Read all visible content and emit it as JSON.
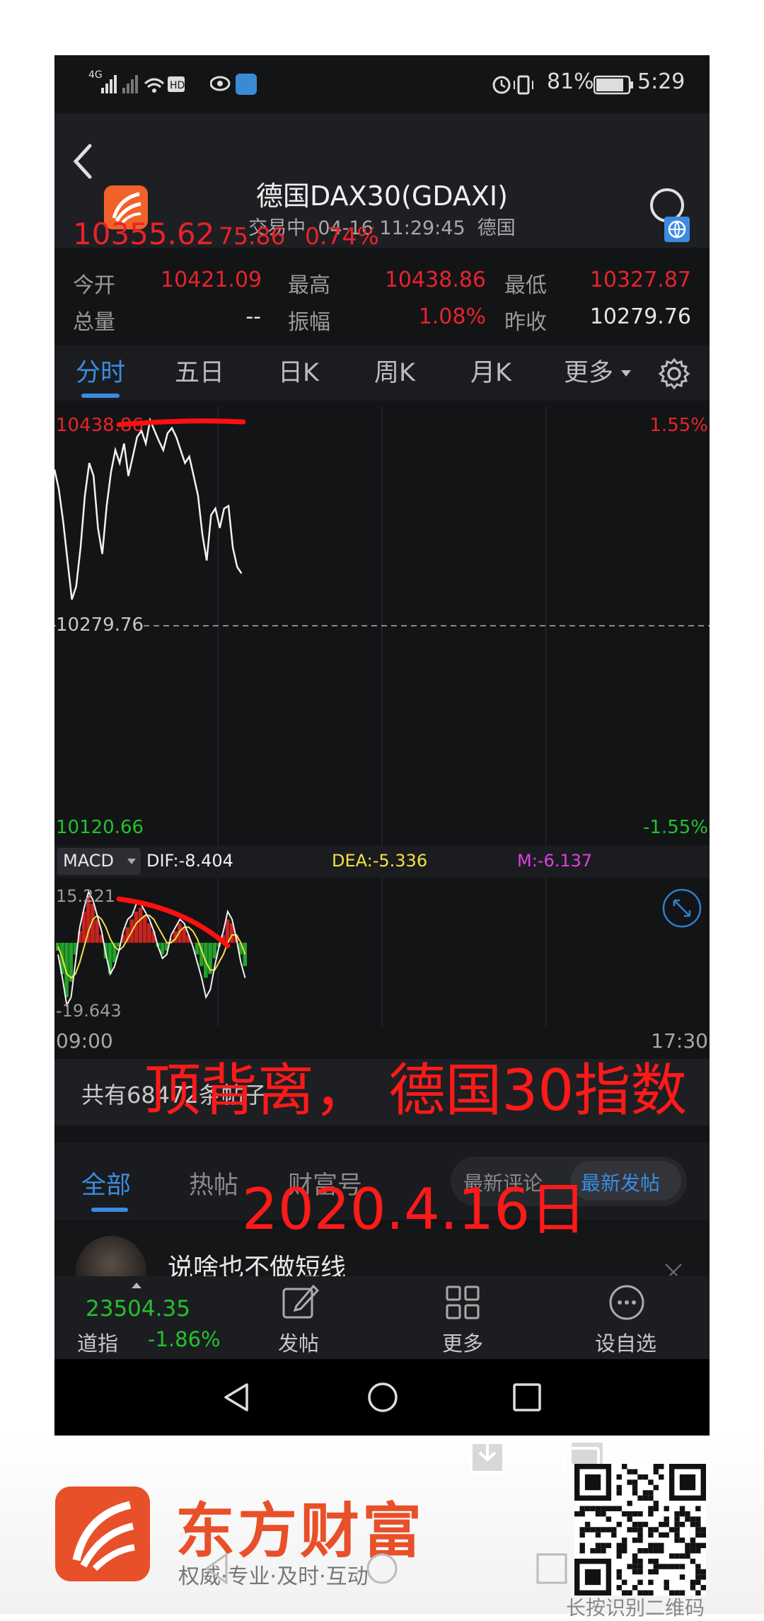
{
  "status": {
    "signal": "4G",
    "battery": "81%",
    "time": "5:29"
  },
  "header": {
    "title": "德国DAX30(GDAXI)",
    "subtitle": "交易中  04-16 11:29:45  德国"
  },
  "quote": {
    "price": "10355.62",
    "change": "75.86",
    "change_pct": "0.74%",
    "open_label": "今开",
    "open": "10421.09",
    "high_label": "最高",
    "high": "10438.86",
    "low_label": "最低",
    "low": "10327.87",
    "volume_label": "总量",
    "volume": "--",
    "amplitude_label": "振幅",
    "amplitude": "1.08%",
    "prev_close_label": "昨收",
    "prev_close": "10279.76"
  },
  "tabs": [
    "分时",
    "五日",
    "日K",
    "周K",
    "月K",
    "更多"
  ],
  "chart_data": {
    "type": "line",
    "title": "",
    "price_top_label": "10438.86",
    "price_mid_label": "10279.76",
    "price_bottom_label": "10120.66",
    "pct_top_label": "1.55%",
    "pct_bottom_label": "-1.55%",
    "ylim": [
      10120.66,
      10438.86
    ],
    "x_start": "09:00",
    "x_end": "17:30",
    "series": [
      {
        "values": [
          10400,
          10385,
          10360,
          10330,
          10300,
          10310,
          10340,
          10380,
          10405,
          10395,
          10355,
          10335,
          10372,
          10398,
          10415,
          10405,
          10420,
          10395,
          10410,
          10425,
          10430,
          10420,
          10438,
          10430,
          10422,
          10415,
          10428,
          10432,
          10425,
          10415,
          10405,
          10410,
          10395,
          10380,
          10350,
          10330,
          10365,
          10370,
          10355,
          10370,
          10372,
          10340,
          10325,
          10320
        ]
      }
    ],
    "macd": {
      "label": "MACD",
      "dif": "DIF:-8.404",
      "dea": "DEA:-5.336",
      "m": "M:-6.137",
      "top_label": "15.221",
      "bottom_label": "-19.643",
      "ylim": [
        -19.643,
        15.221
      ],
      "hist": [
        -2,
        -8,
        -14,
        -10,
        -3,
        3,
        8,
        12,
        10,
        6,
        2,
        -4,
        -8,
        -5,
        -1,
        2,
        4,
        6,
        8,
        9,
        7,
        5,
        3,
        -1,
        -3,
        -2,
        1,
        3,
        5,
        4,
        2,
        0,
        -3,
        -6,
        -9,
        -8,
        -4,
        -1,
        2,
        6,
        5,
        2,
        -3,
        -6
      ],
      "dif_series": [
        -3,
        -9,
        -16,
        -14,
        -5,
        4,
        9,
        13,
        11,
        7,
        3,
        -3,
        -8,
        -6,
        -2,
        3,
        6,
        7,
        10,
        10,
        8,
        6,
        3,
        -1,
        -4,
        -3,
        2,
        4,
        6,
        5,
        2,
        -1,
        -5,
        -9,
        -14,
        -12,
        -6,
        -1,
        3,
        8,
        6,
        1,
        -5,
        -9
      ],
      "dea_series": [
        -1,
        -4,
        -8,
        -9,
        -8,
        -5,
        -1,
        3,
        6,
        7,
        6,
        4,
        1,
        -1,
        -2,
        -1,
        1,
        3,
        5,
        6,
        7,
        7,
        6,
        4,
        2,
        0,
        0,
        1,
        3,
        4,
        4,
        3,
        1,
        -2,
        -5,
        -7,
        -7,
        -5,
        -3,
        0,
        2,
        2,
        0,
        -3
      ]
    }
  },
  "comments": {
    "count_text": "共有68472条帖子",
    "tabs": [
      "全部",
      "热帖",
      "财富号"
    ],
    "sort_left": "最新评论",
    "sort_right": "最新发帖",
    "first_user": "说啥也不做短线"
  },
  "bottom_nav": {
    "index_value": "23504.35",
    "index_name": "道指",
    "index_change": "-1.86%",
    "post": "发帖",
    "more": "更多",
    "watch": "设自选"
  },
  "annotations": {
    "line1": "顶背离， 德国30指数",
    "line2": "2020.4.16日"
  },
  "footer": {
    "brand": "东方财富",
    "slogan": "权威·专业·及时·互动",
    "qr_hint": "长按识别二维码"
  },
  "colors": {
    "up": "#e8232b",
    "down": "#22c22e",
    "accent": "#3b8ce0",
    "bg": "#131416"
  }
}
